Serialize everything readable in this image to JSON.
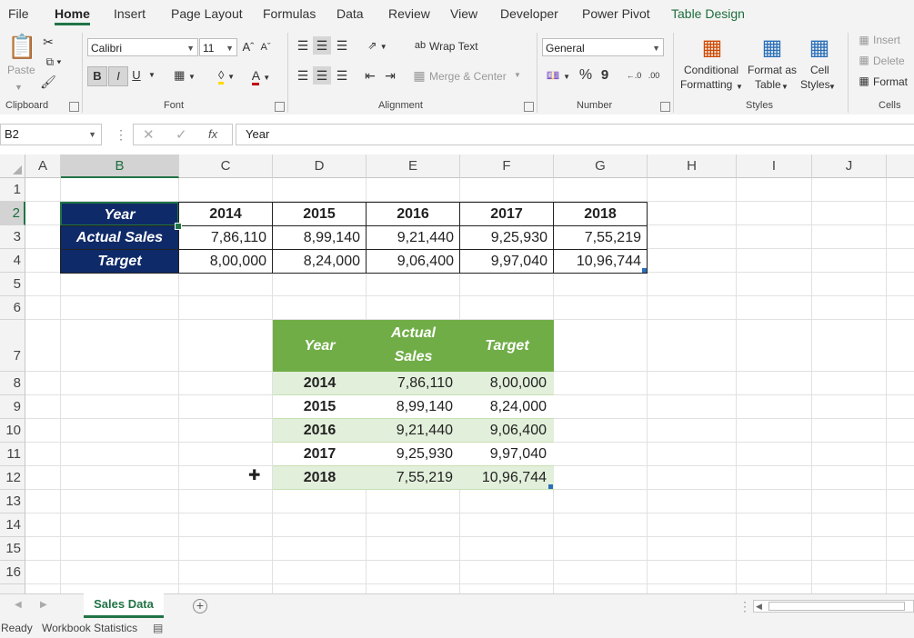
{
  "menu": {
    "tabs": [
      "File",
      "Home",
      "Insert",
      "Page Layout",
      "Formulas",
      "Data",
      "Review",
      "View",
      "Developer",
      "Power Pivot",
      "Table Design"
    ]
  },
  "ribbon": {
    "clipboard": {
      "paste": "Paste",
      "label": "Clipboard"
    },
    "font": {
      "name": "Calibri",
      "size": "11",
      "label": "Font",
      "bold": "B",
      "italic": "I",
      "underline": "U"
    },
    "alignment": {
      "wrap": "Wrap Text",
      "merge": "Merge & Center",
      "label": "Alignment"
    },
    "number": {
      "format": "General",
      "percent": "%",
      "comma": "9",
      "label": "Number"
    },
    "styles": {
      "conditional_1": "Conditional",
      "conditional_2": "Formatting",
      "format_as_1": "Format as",
      "format_as_2": "Table",
      "cell_styles_1": "Cell",
      "cell_styles_2": "Styles",
      "label": "Styles"
    },
    "cells": {
      "insert": "Insert",
      "delete": "Delete",
      "format": "Format",
      "label": "Cells"
    }
  },
  "formula_bar": {
    "name_box": "B2",
    "fx": "fx",
    "value": "Year"
  },
  "columns": [
    "A",
    "B",
    "C",
    "D",
    "E",
    "F",
    "G",
    "H",
    "I",
    "J"
  ],
  "rows": [
    "1",
    "2",
    "3",
    "4",
    "5",
    "6",
    "7",
    "8",
    "9",
    "10",
    "11",
    "12",
    "13",
    "14",
    "15",
    "16"
  ],
  "table1": {
    "year_label": "Year",
    "actual_label": "Actual Sales",
    "target_label": "Target",
    "years": [
      "2014",
      "2015",
      "2016",
      "2017",
      "2018"
    ],
    "actual": [
      "7,86,110",
      "8,99,140",
      "9,21,440",
      "9,25,930",
      "7,55,219"
    ],
    "target": [
      "8,00,000",
      "8,24,000",
      "9,06,400",
      "9,97,040",
      "10,96,744"
    ]
  },
  "table2": {
    "headers": {
      "year": "Year",
      "actual_1": "Actual",
      "actual_2": "Sales",
      "target": "Target"
    },
    "rows": [
      {
        "year": "2014",
        "actual": "7,86,110",
        "target": "8,00,000"
      },
      {
        "year": "2015",
        "actual": "8,99,140",
        "target": "8,24,000"
      },
      {
        "year": "2016",
        "actual": "9,21,440",
        "target": "9,06,400"
      },
      {
        "year": "2017",
        "actual": "9,25,930",
        "target": "9,97,040"
      },
      {
        "year": "2018",
        "actual": "7,55,219",
        "target": "10,96,744"
      }
    ]
  },
  "sheet_tab": "Sales Data",
  "status": {
    "ready": "Ready",
    "stats": "Workbook Statistics"
  },
  "colors": {
    "accent": "#217346",
    "navy": "#0f2a68",
    "green_header": "#70ad47",
    "green_band": "#e2efda"
  }
}
